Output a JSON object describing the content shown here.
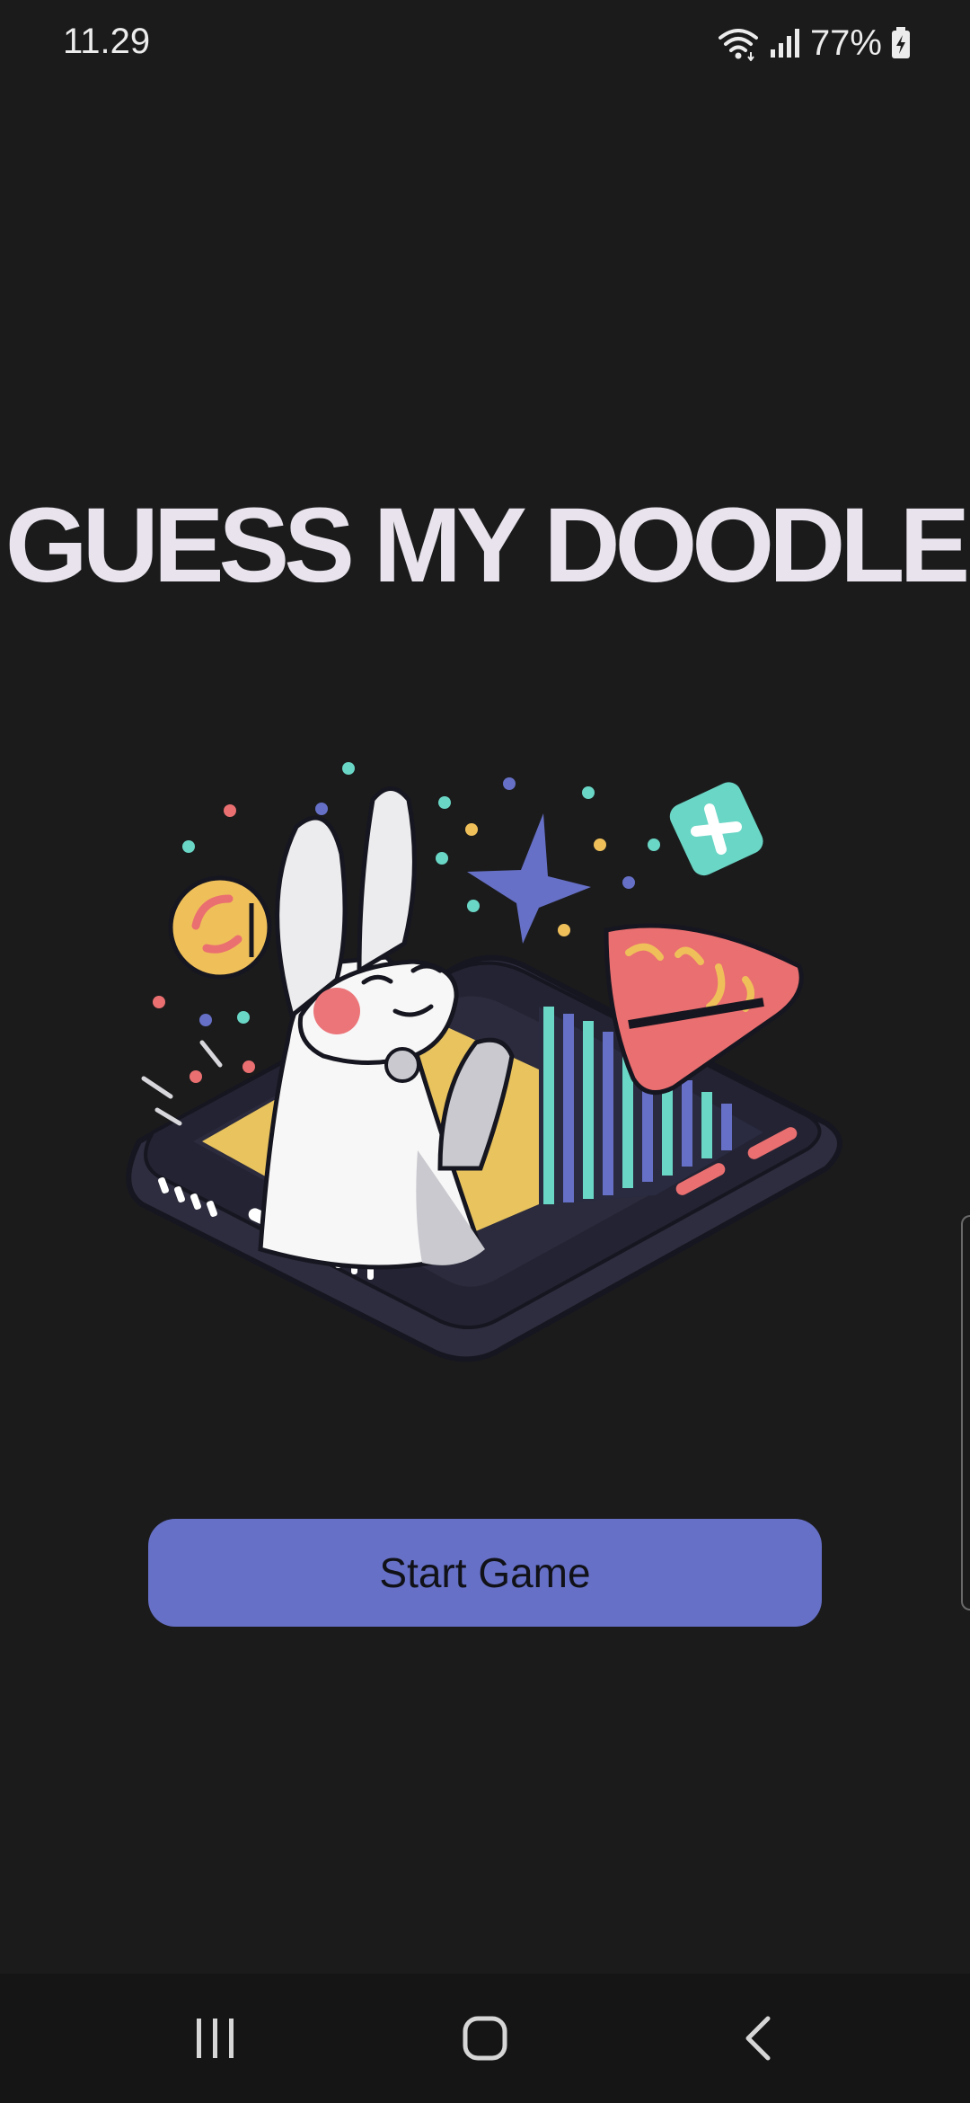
{
  "status_bar": {
    "time": "11.29",
    "battery": "77%",
    "icons": [
      "wifi-icon",
      "signal-icon",
      "battery-charging-icon"
    ]
  },
  "app": {
    "title": "GUESS MY DOODLE",
    "start_button_label": "Start Game"
  },
  "illustration": {
    "subject": "bunny-in-phone-illustration"
  },
  "nav_bar": {
    "icons": [
      "recent-apps-icon",
      "home-icon",
      "back-icon"
    ]
  },
  "colors": {
    "background": "#1b1b1c",
    "accent": "#6670c6",
    "title": "#e8e3ec",
    "nav_bar": "#151515"
  }
}
